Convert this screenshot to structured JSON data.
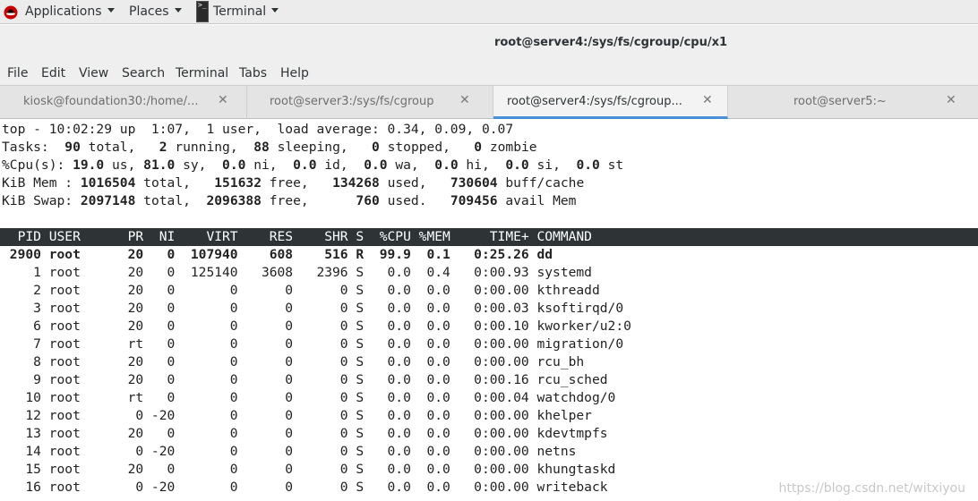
{
  "panel": {
    "applications_label": "Applications",
    "places_label": "Places",
    "terminal_label": "Terminal"
  },
  "window": {
    "title": "root@server4:/sys/fs/cgroup/cpu/x1"
  },
  "menubar": {
    "items": [
      "File",
      "Edit",
      "View",
      "Search",
      "Terminal",
      "Tabs",
      "Help"
    ]
  },
  "tabs": [
    {
      "label": "kiosk@foundation30:/home/...",
      "close": "✕"
    },
    {
      "label": "root@server3:/sys/fs/cgroup",
      "close": "✕"
    },
    {
      "label": "root@server4:/sys/fs/cgroup...",
      "close": "✕"
    },
    {
      "label": "root@server5:~",
      "close": "✕"
    }
  ],
  "top": {
    "summary_line": "top - 10:02:29 up  1:07,  1 user,  load average: 0.34, 0.09, 0.07",
    "tasks_line": {
      "prefix": "Tasks: ",
      "total": " 90",
      "total_label": " total,   ",
      "running": "2",
      "running_label": " running,  ",
      "sleeping": "88",
      "sleeping_label": " sleeping,   ",
      "stopped": "0",
      "stopped_label": " stopped,   ",
      "zombie": "0",
      "zombie_label": " zombie"
    },
    "cpu_line": {
      "prefix": "%Cpu(s): ",
      "us": "19.0",
      "us_label": " us, ",
      "sy": "81.0",
      "sy_label": " sy,  ",
      "ni": "0.0",
      "ni_label": " ni,  ",
      "id": "0.0",
      "id_label": " id,  ",
      "wa": "0.0",
      "wa_label": " wa,  ",
      "hi": "0.0",
      "hi_label": " hi,  ",
      "si": "0.0",
      "si_label": " si,  ",
      "st": "0.0",
      "st_label": " st"
    },
    "mem_line": {
      "prefix": "KiB Mem : ",
      "total": "1016504",
      "total_label": " total,   ",
      "free": "151632",
      "free_label": " free,   ",
      "used": "134268",
      "used_label": " used,   ",
      "buff": "730604",
      "buff_label": " buff/cache"
    },
    "swap_line": {
      "prefix": "KiB Swap: ",
      "total": "2097148",
      "total_label": " total,  ",
      "free": "2096388",
      "free_label": " free,      ",
      "used": "760",
      "used_label": " used.   ",
      "avail": "709456",
      "avail_label": " avail Mem"
    },
    "header": "  PID USER      PR  NI    VIRT    RES    SHR S  %CPU %MEM     TIME+ COMMAND",
    "processes": [
      {
        "text": " 2900 root      20   0  107940    608    516 R  99.9  0.1   0:25.26 dd",
        "bold": true
      },
      {
        "text": "    1 root      20   0  125140   3608   2396 S   0.0  0.4   0:00.93 systemd",
        "bold": false
      },
      {
        "text": "    2 root      20   0       0      0      0 S   0.0  0.0   0:00.00 kthreadd",
        "bold": false
      },
      {
        "text": "    3 root      20   0       0      0      0 S   0.0  0.0   0:00.03 ksoftirqd/0",
        "bold": false
      },
      {
        "text": "    6 root      20   0       0      0      0 S   0.0  0.0   0:00.10 kworker/u2:0",
        "bold": false
      },
      {
        "text": "    7 root      rt   0       0      0      0 S   0.0  0.0   0:00.00 migration/0",
        "bold": false
      },
      {
        "text": "    8 root      20   0       0      0      0 S   0.0  0.0   0:00.00 rcu_bh",
        "bold": false
      },
      {
        "text": "    9 root      20   0       0      0      0 S   0.0  0.0   0:00.16 rcu_sched",
        "bold": false
      },
      {
        "text": "   10 root      rt   0       0      0      0 S   0.0  0.0   0:00.04 watchdog/0",
        "bold": false
      },
      {
        "text": "   12 root       0 -20       0      0      0 S   0.0  0.0   0:00.00 khelper",
        "bold": false
      },
      {
        "text": "   13 root      20   0       0      0      0 S   0.0  0.0   0:00.00 kdevtmpfs",
        "bold": false
      },
      {
        "text": "   14 root       0 -20       0      0      0 S   0.0  0.0   0:00.00 netns",
        "bold": false
      },
      {
        "text": "   15 root      20   0       0      0      0 S   0.0  0.0   0:00.00 khungtaskd",
        "bold": false
      },
      {
        "text": "   16 root       0 -20       0      0      0 S   0.0  0.0   0:00.00 writeback",
        "bold": false
      }
    ]
  },
  "watermark": "https://blog.csdn.net/witxiyou",
  "colors": {
    "terminal_bg": "#ffffff",
    "header_bg": "#2e3436",
    "tab_accent": "#4a90d9"
  }
}
